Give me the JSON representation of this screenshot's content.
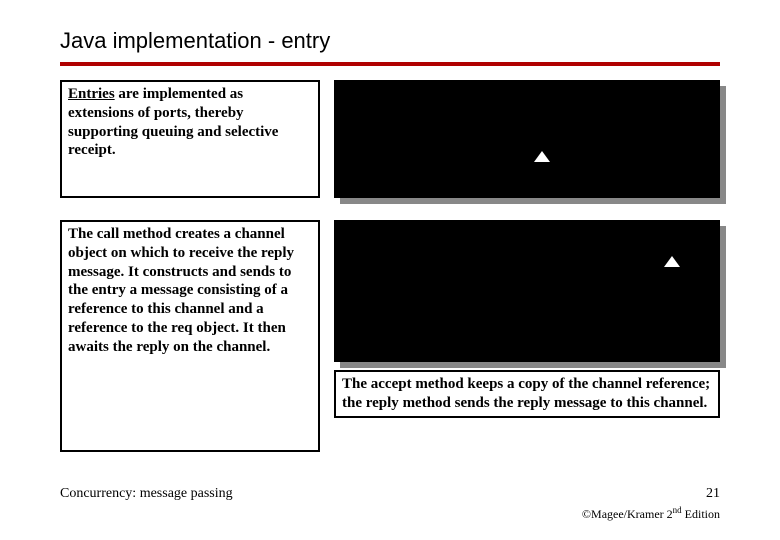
{
  "title": "Java implementation - entry",
  "box1_pre": "",
  "box1_u": "Entries",
  "box1_post": " are implemented as extensions of ports, thereby supporting queuing and selective receipt.",
  "box2_a": "The ",
  "box2_b": "call",
  "box2_c": " method creates a channel object on which to receive the reply message. It constructs and sends to the entry a message consisting of a reference to this channel and a reference to the req object. It then awaits the reply on the channel.",
  "box3_a": "The ",
  "box3_b": "accept",
  "box3_c": " method keeps a copy of the channel reference; the ",
  "box3_d": "reply",
  "box3_e": " method sends the reply message to this channel.",
  "footer_left": "Concurrency: message passing",
  "page_num": "21",
  "copyright_a": "©Magee/Kramer ",
  "copyright_b": "2",
  "copyright_c": "nd",
  "copyright_d": " Edition"
}
